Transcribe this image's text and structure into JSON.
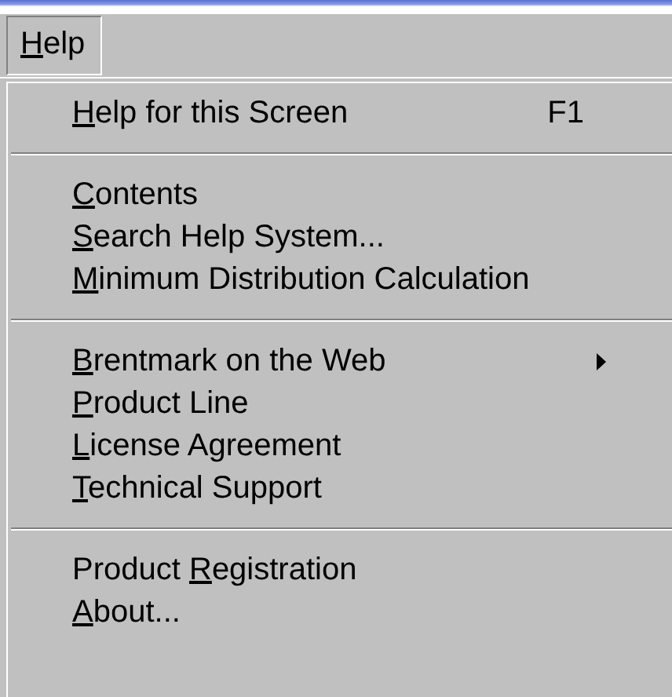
{
  "menu_bar": {
    "items": [
      {
        "access_key": "H",
        "label_end": "elp",
        "selected": true
      }
    ]
  },
  "menu": {
    "groups": [
      [
        {
          "access_key": "H",
          "label_end": "elp for this Screen",
          "shortcut": "F1",
          "submenu": false
        }
      ],
      [
        {
          "access_key": "C",
          "label_end": "ontents",
          "submenu": false
        },
        {
          "access_key": "S",
          "label_end": "earch Help System...",
          "submenu": false
        },
        {
          "access_key": "M",
          "label_end": "inimum Distribution Calculation",
          "submenu": false
        }
      ],
      [
        {
          "access_key": "B",
          "label_end": "rentmark on the Web",
          "submenu": true
        },
        {
          "access_key": "P",
          "label_end": "roduct Line",
          "submenu": false
        },
        {
          "access_key": "L",
          "label_end": "icense Agreement",
          "submenu": false
        },
        {
          "access_key": "T",
          "label_end": "echnical Support",
          "submenu": false
        }
      ],
      [
        {
          "label_start": "Product ",
          "access_key": "R",
          "label_end": "egistration",
          "submenu": false
        },
        {
          "access_key": "A",
          "label_end": "bout...",
          "submenu": false
        }
      ]
    ]
  }
}
